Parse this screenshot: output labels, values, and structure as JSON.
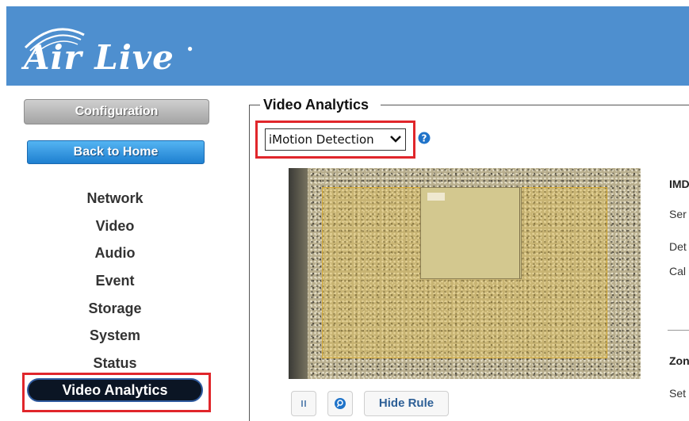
{
  "header": {
    "logo_text": "Air Live",
    "brand_color": "#4e8fcf"
  },
  "sidebar": {
    "config_label": "Configuration",
    "home_label": "Back to Home",
    "items": [
      {
        "label": "Network"
      },
      {
        "label": "Video"
      },
      {
        "label": "Audio"
      },
      {
        "label": "Event"
      },
      {
        "label": "Storage"
      },
      {
        "label": "System"
      },
      {
        "label": "Status"
      }
    ],
    "active_label": "Video Analytics",
    "highlight_color": "#e0262b"
  },
  "main": {
    "section_title": "Video Analytics",
    "mode_select": {
      "value": "iMotion Detection"
    },
    "help_icon": "question-circle-icon",
    "panel_text": [
      "IMD",
      "Ser",
      "Det",
      "Cal",
      "Zon",
      "Set"
    ],
    "controls": {
      "pause_icon": "pause-icon",
      "search_icon": "search-icon",
      "hide_rule_label": "Hide Rule"
    }
  }
}
